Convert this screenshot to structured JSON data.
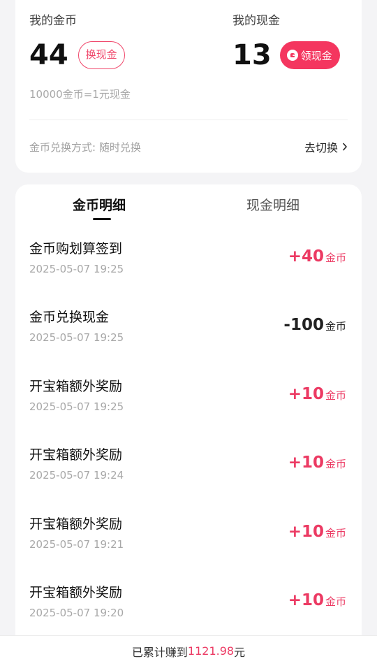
{
  "coins": {
    "label": "我的金币",
    "amount": "44",
    "exchange_button": "换现金"
  },
  "cash": {
    "label": "我的现金",
    "amount": "13",
    "withdraw_button": "领现金",
    "withdraw_icon": "wallet-icon"
  },
  "rate_note": "10000金币=1元现金",
  "exchange_method": {
    "label": "金币兑换方式:  随时兑换",
    "switch_label": "去切换"
  },
  "tabs": [
    {
      "label": "金币明细",
      "active": true
    },
    {
      "label": "现金明细",
      "active": false
    }
  ],
  "records": [
    {
      "title": "金币购划算签到",
      "time": "2025-05-07 19:25",
      "amount": "+40",
      "unit": "金币",
      "sign": "positive"
    },
    {
      "title": "金币兑换现金",
      "time": "2025-05-07 19:25",
      "amount": "-100",
      "unit": "金币",
      "sign": "negative"
    },
    {
      "title": "开宝箱额外奖励",
      "time": "2025-05-07 19:25",
      "amount": "+10",
      "unit": "金币",
      "sign": "positive"
    },
    {
      "title": "开宝箱额外奖励",
      "time": "2025-05-07 19:24",
      "amount": "+10",
      "unit": "金币",
      "sign": "positive"
    },
    {
      "title": "开宝箱额外奖励",
      "time": "2025-05-07 19:21",
      "amount": "+10",
      "unit": "金币",
      "sign": "positive"
    },
    {
      "title": "开宝箱额外奖励",
      "time": "2025-05-07 19:20",
      "amount": "+10",
      "unit": "金币",
      "sign": "positive"
    }
  ],
  "footer": {
    "prefix": "已累计赚到",
    "total": "1121.98",
    "suffix": "元"
  },
  "colors": {
    "accent": "#f4365f",
    "positive_amount": "#ec3a63",
    "background": "#f4f4f6"
  }
}
